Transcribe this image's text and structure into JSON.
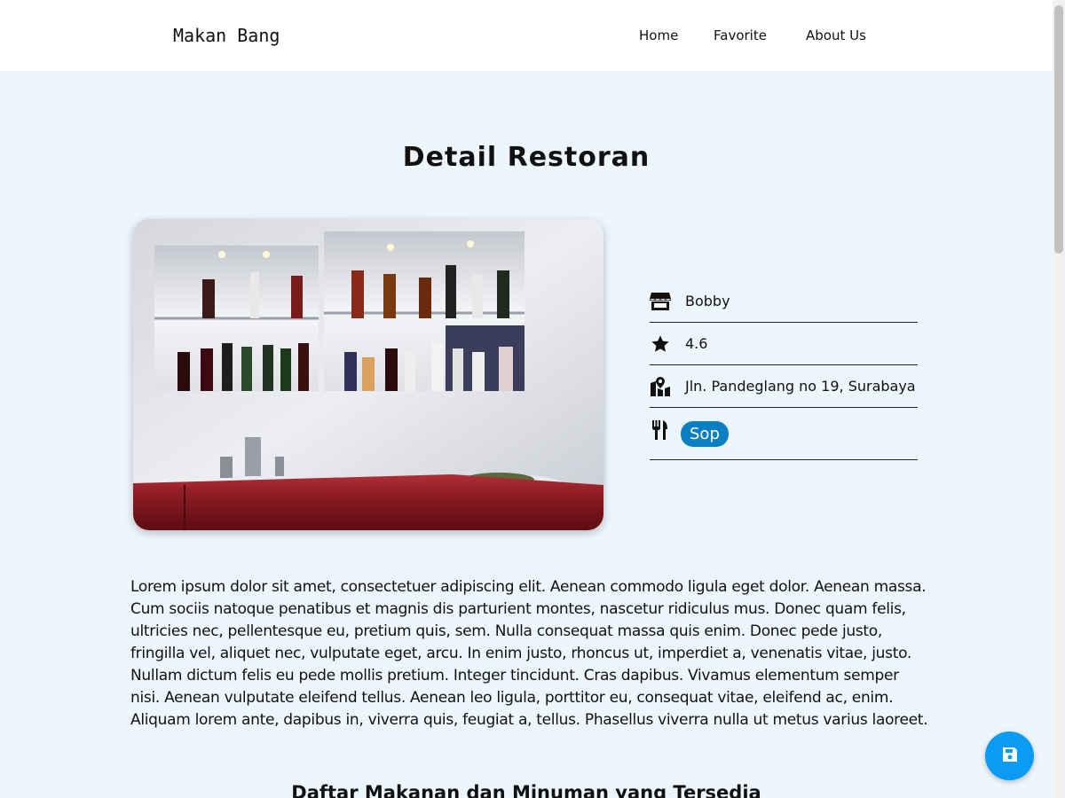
{
  "header": {
    "brand": "Makan Bang",
    "nav": [
      {
        "label": "Home"
      },
      {
        "label": "Favorite"
      },
      {
        "label": "About Us"
      }
    ]
  },
  "page": {
    "title": "Detail Restoran"
  },
  "restaurant": {
    "name": "Bobby",
    "rating": "4.6",
    "address": "Jln. Pandeglang no 19, Surabaya",
    "category": "Sop",
    "description": "Lorem ipsum dolor sit amet, consectetuer adipiscing elit. Aenean commodo ligula eget dolor. Aenean massa. Cum sociis natoque penatibus et magnis dis parturient montes, nascetur ridiculus mus. Donec quam felis, ultricies nec, pellentesque eu, pretium quis, sem. Nulla consequat massa quis enim. Donec pede justo, fringilla vel, aliquet nec, vulputate eget, arcu. In enim justo, rhoncus ut, imperdiet a, venenatis vitae, justo. Nullam dictum felis eu pede mollis pretium. Integer tincidunt. Cras dapibus. Vivamus elementum semper nisi. Aenean vulputate eleifend tellus. Aenean leo ligula, porttitor eu, consequat vitae, eleifend ac, enim. Aliquam lorem ante, dapibus in, viverra quis, feugiat a, tellus. Phasellus viverra nulla ut metus varius laoreet."
  },
  "menu": {
    "heading": "Daftar Makanan dan Minuman yang Tersedia"
  },
  "icons": {
    "store": "store-icon",
    "rating": "star-icon",
    "address": "map-location-icon",
    "category": "utensils-icon",
    "save": "save-icon"
  },
  "colors": {
    "page_background": "#eef6fd",
    "badge": "#0a7fc2",
    "fab": "#0a9cf5"
  }
}
